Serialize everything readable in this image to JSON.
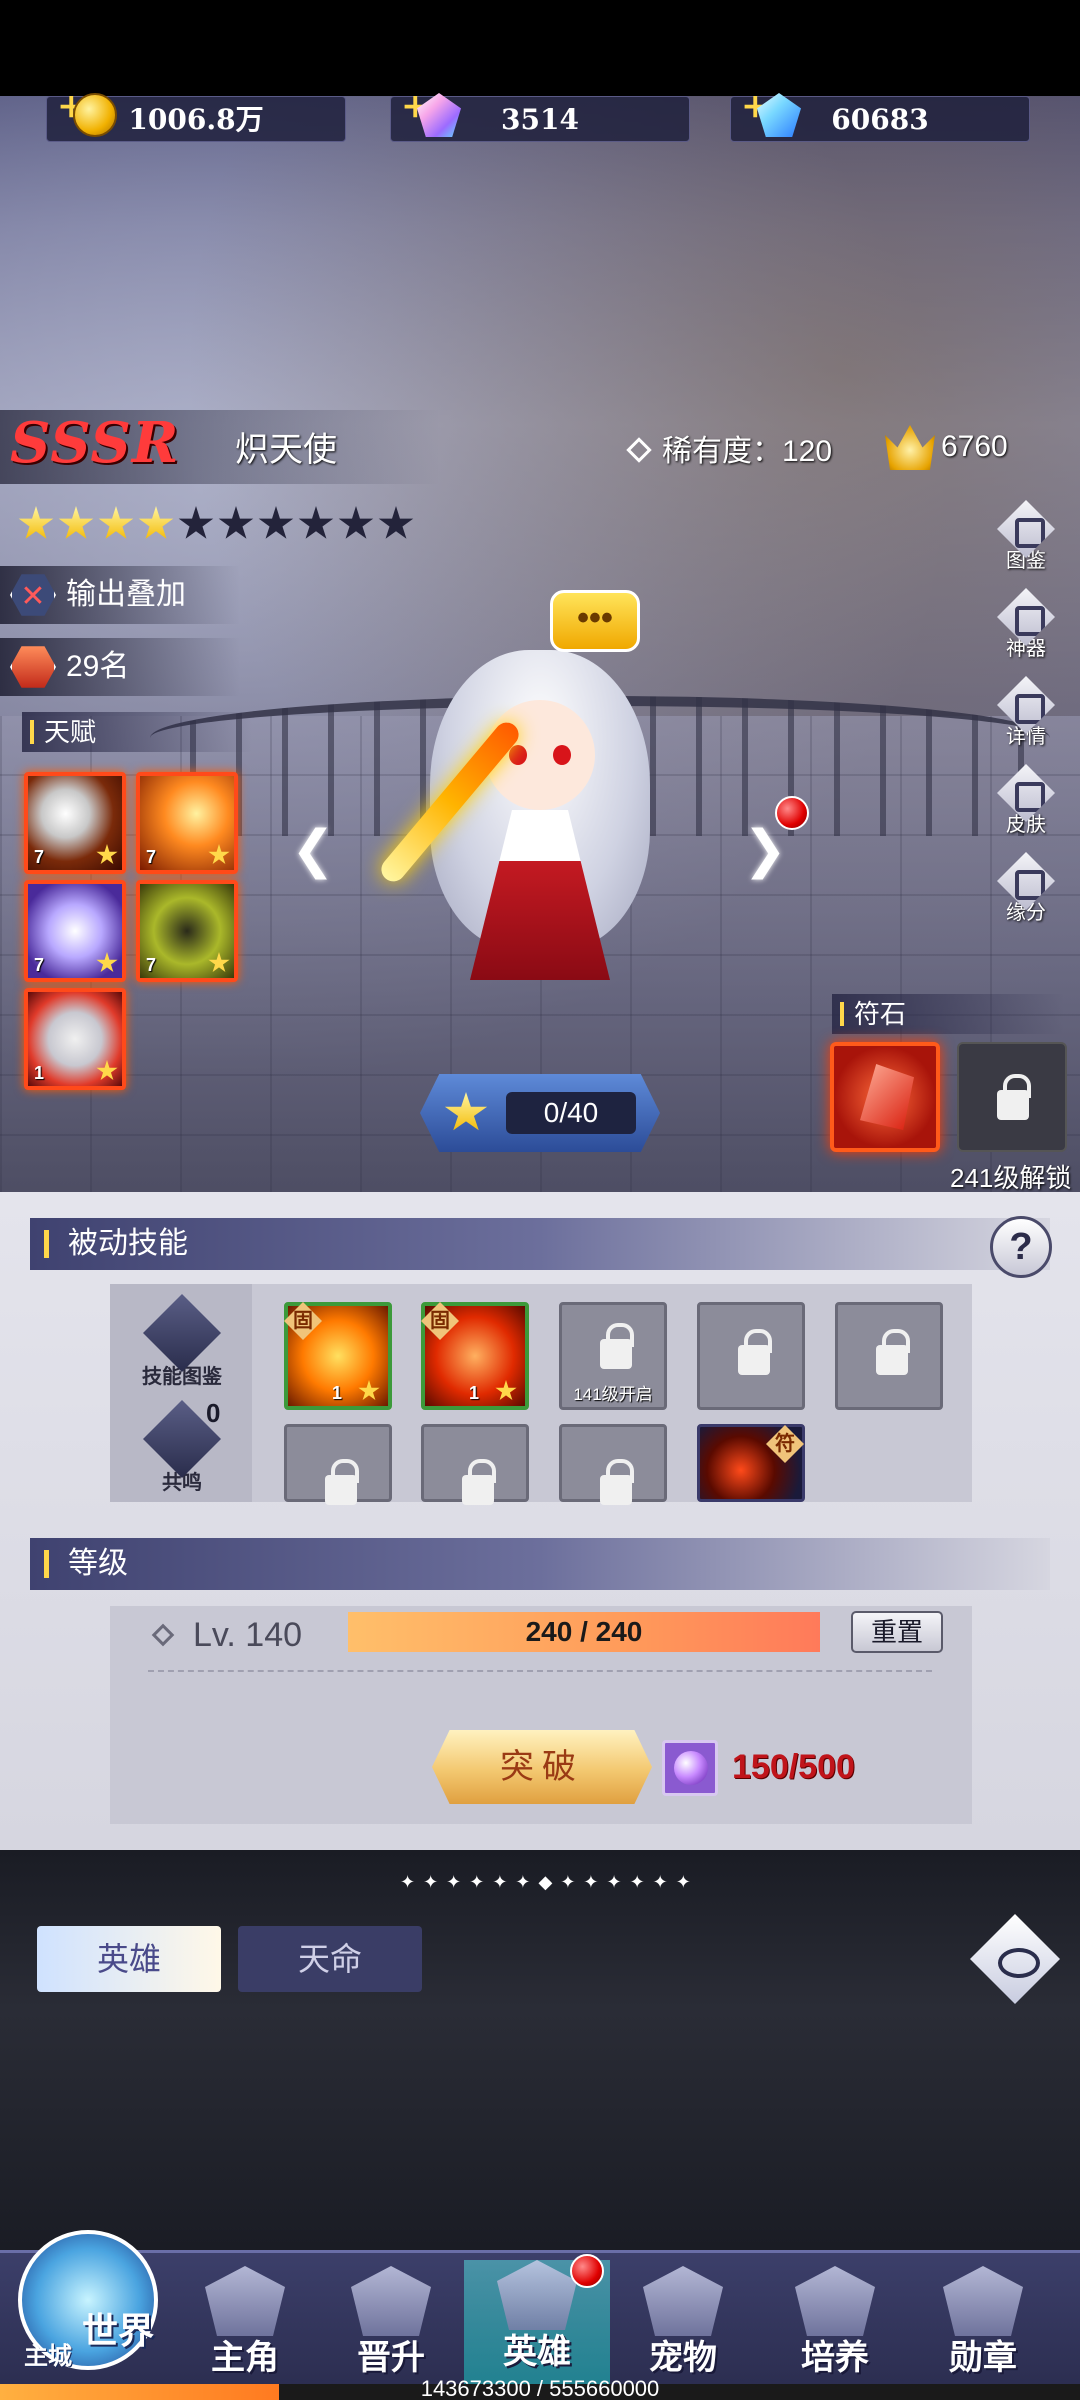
{
  "currencies": {
    "gold": "1006.8万",
    "gem_pink": "3514",
    "gem_blue": "60683"
  },
  "hero": {
    "rarity": "SSSR",
    "name": "炽天使",
    "rarity_value": "稀有度：120",
    "power": "6760",
    "stars_total": 10,
    "stars_filled": 4,
    "tag_type": "输出叠加",
    "rank": "29名"
  },
  "talent": {
    "title": "天赋",
    "items": [
      {
        "level": "7",
        "icon": "crescent-blade-icon"
      },
      {
        "level": "7",
        "icon": "fire-slash-icon"
      },
      {
        "level": "7",
        "icon": "wind-swirl-icon"
      },
      {
        "level": "7",
        "icon": "shadow-figure-icon"
      },
      {
        "level": "1",
        "icon": "spear-tip-icon"
      }
    ]
  },
  "side_menu": [
    {
      "label": "图鉴"
    },
    {
      "label": "神器"
    },
    {
      "label": "详情"
    },
    {
      "label": "皮肤"
    },
    {
      "label": "缘分"
    }
  ],
  "rune": {
    "title": "符石",
    "unlock_text": "241级解锁"
  },
  "exp_pill": "0/40",
  "passive": {
    "title": "被动技能",
    "help": "?",
    "side_buttons": {
      "codex": "技能图鉴",
      "resonance": "共鸣",
      "resonance_count": "0"
    },
    "row1": [
      {
        "state": "fixed",
        "tag": "固",
        "level": "1"
      },
      {
        "state": "fixed",
        "tag": "固",
        "level": "1"
      },
      {
        "state": "locked",
        "unlock": "141级开启"
      },
      {
        "state": "locked"
      },
      {
        "state": "locked"
      }
    ],
    "row2": [
      {
        "state": "locked"
      },
      {
        "state": "locked"
      },
      {
        "state": "locked"
      },
      {
        "state": "special",
        "tag": "符"
      }
    ]
  },
  "level": {
    "title": "等级",
    "label": "Lv. 140",
    "exp": "240 / 240",
    "exp_fraction": 1.0,
    "reset": "重置",
    "breakthrough": "突破",
    "material": "150/500"
  },
  "tabs": {
    "hero": "英雄",
    "destiny": "天命"
  },
  "nav": {
    "world": "世界",
    "main_city": "主城",
    "items": [
      {
        "label": "主角"
      },
      {
        "label": "晋升"
      },
      {
        "label": "英雄"
      },
      {
        "label": "宠物"
      },
      {
        "label": "培养"
      },
      {
        "label": "勋章"
      }
    ]
  },
  "download": {
    "text": "143673300 / 555660000",
    "fraction": 0.2586
  },
  "colors": {
    "accent_gold": "#ffd84a",
    "rarity_red": "#ff3b3b",
    "panel_bg": "#e4e4ec",
    "nav_active": "#3ec8c8"
  }
}
